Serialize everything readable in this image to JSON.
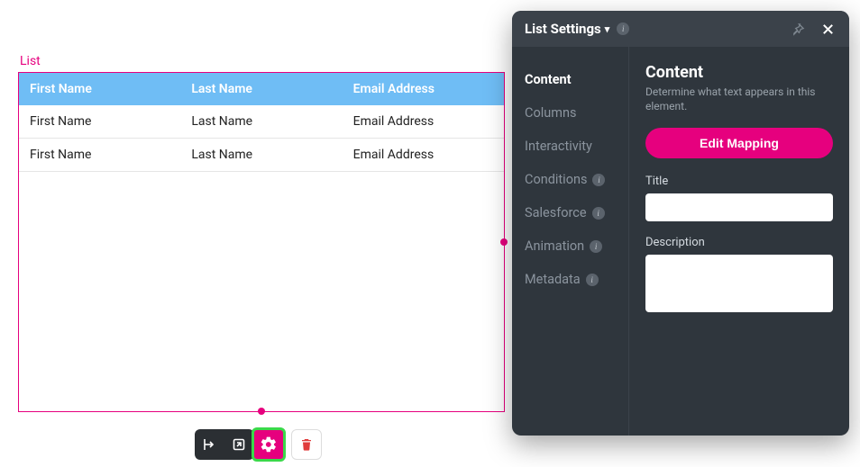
{
  "list": {
    "label": "List",
    "headers": [
      "First Name",
      "Last Name",
      "Email Address"
    ],
    "rows": [
      [
        "First Name",
        "Last Name",
        "Email Address"
      ],
      [
        "First Name",
        "Last Name",
        "Email Address"
      ]
    ]
  },
  "toolbar": {
    "align_icon": "align-left",
    "open_icon": "open-external",
    "gear_icon": "gear",
    "trash_icon": "trash"
  },
  "panel": {
    "title": "List Settings",
    "nav": [
      {
        "label": "Content",
        "active": true,
        "info": false
      },
      {
        "label": "Columns",
        "active": false,
        "info": false
      },
      {
        "label": "Interactivity",
        "active": false,
        "info": false
      },
      {
        "label": "Conditions",
        "active": false,
        "info": true
      },
      {
        "label": "Salesforce",
        "active": false,
        "info": true
      },
      {
        "label": "Animation",
        "active": false,
        "info": true
      },
      {
        "label": "Metadata",
        "active": false,
        "info": true
      }
    ],
    "content": {
      "heading": "Content",
      "subtext": "Determine what text appears in this element.",
      "edit_mapping_label": "Edit Mapping",
      "title_label": "Title",
      "title_value": "",
      "description_label": "Description",
      "description_value": ""
    }
  }
}
